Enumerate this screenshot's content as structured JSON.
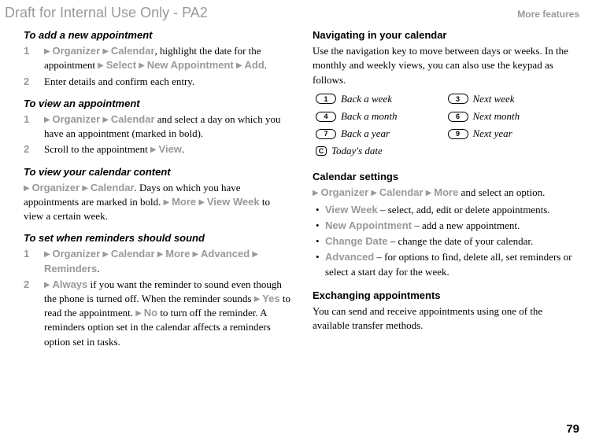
{
  "header": {
    "draft": "Draft for Internal Use Only - PA2",
    "section": "More features"
  },
  "left": {
    "s1": {
      "title": "To add a new appointment",
      "step1_num": "1",
      "step1_m1": "Organizer",
      "step1_m2": "Calendar",
      "step1_t1": ",  highlight the date for the appointment ",
      "step1_m3": "Select",
      "step1_m4": "New Appointment",
      "step1_m5": "Add",
      "step1_t2": ".",
      "step2_num": "2",
      "step2_t": "Enter details and confirm each entry."
    },
    "s2": {
      "title": "To view an appointment",
      "step1_num": "1",
      "step1_m1": "Organizer",
      "step1_m2": "Calendar",
      "step1_t": " and select a day on which you have an appointment (marked in bold).",
      "step2_num": "2",
      "step2_t1": "Scroll to the appointment ",
      "step2_m1": "View",
      "step2_t2": "."
    },
    "s3": {
      "title": "To view your calendar content",
      "m1": "Organizer",
      "m2": "Calendar",
      "t1": ". Days on which you have appointments are marked in bold. ",
      "m3": "More",
      "m4": "View Week",
      "t2": " to view a certain week."
    },
    "s4": {
      "title": "To set when reminders should sound",
      "step1_num": "1",
      "step1_m1": "Organizer",
      "step1_m2": "Calendar",
      "step1_m3": "More",
      "step1_m4": "Advanced",
      "step1_m5": "Reminders",
      "step1_t": ".",
      "step2_num": "2",
      "step2_m1": "Always",
      "step2_t1": " if you want the reminder to sound even though the phone is turned off. When the reminder sounds ",
      "step2_m2": "Yes",
      "step2_t2": " to read the appointment. ",
      "step2_m3": "No",
      "step2_t3": " to turn off the reminder. A reminders option set in the calendar affects a reminders option set in tasks."
    }
  },
  "right": {
    "nav": {
      "title": "Navigating in your calendar",
      "body": "Use the navigation key to move between days or weeks. In the monthly and weekly views, you can also use the keypad as follows.",
      "k1": "1",
      "k1label": "Back a week",
      "k3": "3",
      "k3label": "Next week",
      "k4": "4",
      "k4label": "Back a month",
      "k6": "6",
      "k6label": "Next month",
      "k7": "7",
      "k7label": "Back a year",
      "k9": "9",
      "k9label": "Next year",
      "kc": "C",
      "kclabel": "Today's date"
    },
    "settings": {
      "title": "Calendar settings",
      "m1": "Organizer",
      "m2": "Calendar",
      "m3": "More",
      "t1": " and select an option.",
      "b1_m": "View Week",
      "b1_t": " – select, add, edit or delete appointments.",
      "b2_m": "New Appointment",
      "b2_t": " – add a new appointment.",
      "b3_m": "Change Date",
      "b3_t": " – change the date of your calendar.",
      "b4_m": "Advanced",
      "b4_t": " – for options to find, delete all, set reminders or select a start day for the week."
    },
    "exch": {
      "title": "Exchanging appointments",
      "body": "You can send and receive appointments using one of the available transfer methods."
    }
  },
  "pagenum": "79"
}
